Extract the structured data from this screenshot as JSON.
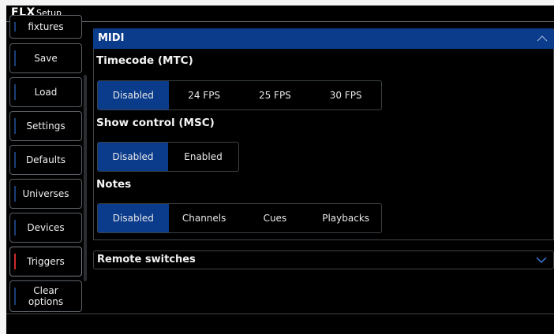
{
  "window": {
    "logo": "FLX",
    "title": "Setup"
  },
  "sidebar": {
    "items": [
      {
        "label": "fixtures",
        "active": false
      },
      {
        "label": "Save",
        "active": false
      },
      {
        "label": "Load",
        "active": false
      },
      {
        "label": "Settings",
        "active": false
      },
      {
        "label": "Defaults",
        "active": false
      },
      {
        "label": "Universes",
        "active": false
      },
      {
        "label": "Devices",
        "active": false
      },
      {
        "label": "Triggers",
        "active": true
      },
      {
        "label": "Clear options",
        "active": false
      }
    ]
  },
  "midi": {
    "header": "MIDI",
    "expanded": true,
    "collapse_icon": "chevron-up-icon",
    "timecode": {
      "label": "Timecode (MTC)",
      "options": [
        "Disabled",
        "24 FPS",
        "25 FPS",
        "30 FPS"
      ],
      "selected": "Disabled"
    },
    "show_control": {
      "label": "Show control (MSC)",
      "options": [
        "Disabled",
        "Enabled"
      ],
      "selected": "Disabled"
    },
    "notes": {
      "label": "Notes",
      "options": [
        "Disabled",
        "Channels",
        "Cues",
        "Playbacks"
      ],
      "selected": "Disabled"
    }
  },
  "remote_switches": {
    "header": "Remote switches",
    "expanded": false,
    "expand_icon": "chevron-down-icon"
  },
  "colors": {
    "accent_blue": "#0b3c8c",
    "active_red": "#cc2a2a",
    "background": "#000000"
  }
}
